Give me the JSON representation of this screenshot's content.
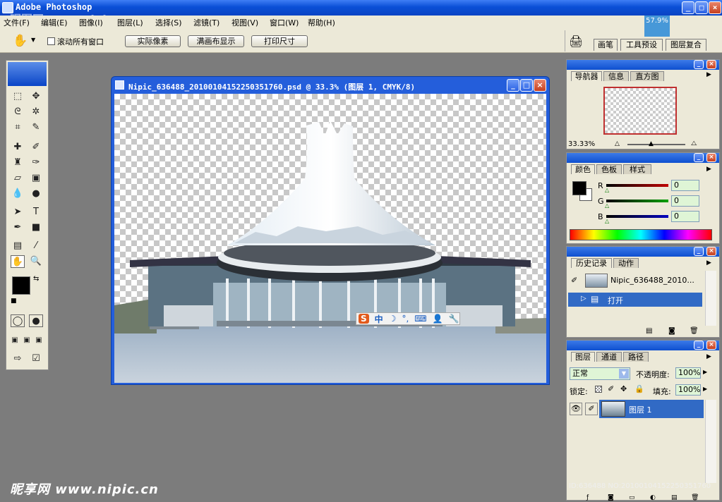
{
  "app": {
    "title": "Adobe Photoshop"
  },
  "window_controls": {
    "min": "_",
    "max": "□",
    "close": "×"
  },
  "menu": [
    "文件(F)",
    "编辑(E)",
    "图像(I)",
    "图层(L)",
    "选择(S)",
    "滤镜(T)",
    "视图(V)",
    "窗口(W)",
    "帮助(H)"
  ],
  "options": {
    "tool_icon": "hand-icon",
    "scroll_all_label": "滚动所有窗口",
    "actual_pixels": "实际像素",
    "fit_screen": "满画布显示",
    "print_size": "打印尺寸"
  },
  "zoom_chip": "57.9%",
  "palette_well": [
    "画笔",
    "工具预设",
    "图层复合"
  ],
  "document": {
    "title": "Nipic_636488_20100104152250351760.psd @ 33.3% (图层 1, CMYK/8)",
    "ime_bar": {
      "s": "S",
      "zh": "中",
      "moon": "☽",
      "dot": "°,"
    }
  },
  "navigator": {
    "tabs": [
      "导航器",
      "信息",
      "直方图"
    ],
    "zoom": "33.33%"
  },
  "color": {
    "tabs": [
      "颜色",
      "色板",
      "样式"
    ],
    "channels": [
      {
        "label": "R",
        "value": "0",
        "color": "#c00000"
      },
      {
        "label": "G",
        "value": "0",
        "color": "#00a000"
      },
      {
        "label": "B",
        "value": "0",
        "color": "#0000c0"
      }
    ]
  },
  "history": {
    "tabs": [
      "历史记录",
      "动作"
    ],
    "snapshot": "Nipic_636488_2010...",
    "items": [
      "打开"
    ]
  },
  "layers": {
    "tabs": [
      "图层",
      "通道",
      "路径"
    ],
    "blend": "正常",
    "opacity_label": "不透明度:",
    "opacity": "100%",
    "lock_label": "锁定:",
    "fill_label": "填充:",
    "fill": "100%",
    "items": [
      "图层 1"
    ]
  },
  "watermarks": {
    "top": "昵图网 www.nipic.com",
    "bottom": "昵享网 www.nipic.cn",
    "id": "ID:636488 NO:20100104152250351760"
  }
}
